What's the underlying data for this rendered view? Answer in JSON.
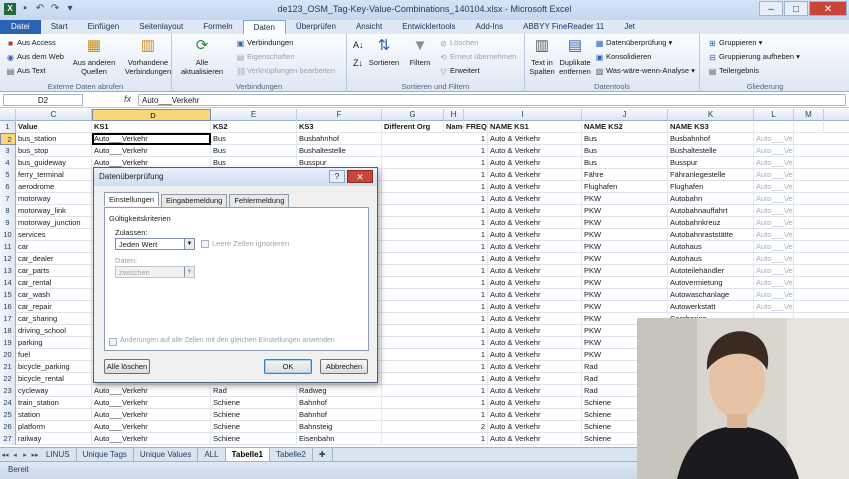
{
  "window": {
    "title": "de123_OSM_Tag-Key-Value-Combinations_140104.xlsx - Microsoft Excel"
  },
  "tabs": [
    "Datei",
    "Start",
    "Einfügen",
    "Seitenlayout",
    "Formeln",
    "Daten",
    "Überprüfen",
    "Ansicht",
    "Entwicklertools",
    "Add-Ins",
    "ABBYY FineReader 11",
    "Jet"
  ],
  "active_tab": "Daten",
  "ribbon": {
    "external": {
      "items": [
        "Aus Access",
        "Aus dem Web",
        "Aus Text"
      ],
      "other_sources": "Aus anderen Quellen",
      "existing": "Vorhandene Verbindungen",
      "label": "Externe Daten abrufen"
    },
    "connections": {
      "refresh": "Alle aktualisieren",
      "items": [
        "Verbindungen",
        "Eigenschaften",
        "Verknüpfungen bearbeiten"
      ],
      "label": "Verbindungen"
    },
    "sort": {
      "items": [
        "Sortieren",
        "Filtern"
      ],
      "side": [
        "Löschen",
        "Erneut übernehmen",
        "Erweitert"
      ],
      "label": "Sortieren und Filtern"
    },
    "tools": {
      "big": [
        "Text in Spalten",
        "Duplikate entfernen"
      ],
      "items": [
        "Datenüberprüfung",
        "Konsolidieren",
        "Was-wäre-wenn-Analyse"
      ],
      "label": "Datentools"
    },
    "outline": {
      "items": [
        "Gruppieren",
        "Gruppierung aufheben",
        "Teilergebnis"
      ],
      "label": "Gliederung"
    }
  },
  "formula_bar": {
    "cell": "D2",
    "fx": "fx",
    "value": "Auto___Verkehr"
  },
  "columns": [
    "C",
    "D",
    "E",
    "F",
    "G",
    "H",
    "I",
    "J",
    "K",
    "L",
    "M"
  ],
  "header_row": [
    "Value",
    "KS1",
    "KS2",
    "KS3",
    "Different Org",
    "Name",
    "FREQ",
    "NAME KS1",
    "NAME KS2",
    "NAME KS3",
    "",
    ""
  ],
  "rows": [
    {
      "n": "2",
      "v": "bus_station",
      "ks1": "Auto___Verkehr",
      "ks2": "Bus",
      "ks3": "Busbahnhof",
      "f": "1",
      "k1": "Auto & Verkehr",
      "k2": "Bus",
      "k3": "Busbahnhof",
      "l": "Auto___Verkehr"
    },
    {
      "n": "3",
      "v": "bus_stop",
      "ks1": "Auto___Verkehr",
      "ks2": "Bus",
      "ks3": "Bushaltestelle",
      "f": "1",
      "k1": "Auto & Verkehr",
      "k2": "Bus",
      "k3": "Bushaltestelle",
      "l": "Auto___Verkehr"
    },
    {
      "n": "4",
      "v": "bus_guideway",
      "ks1": "Auto___Verkehr",
      "ks2": "Bus",
      "ks3": "Busspur",
      "f": "1",
      "k1": "Auto & Verkehr",
      "k2": "Bus",
      "k3": "Busspur",
      "l": "Auto___Verkehr"
    },
    {
      "n": "5",
      "v": "ferry_terminal",
      "ks1": "Auto___Verkehr",
      "ks2": "",
      "ks3": "",
      "f": "1",
      "k1": "Auto & Verkehr",
      "k2": "Fähre",
      "k3": "Fähranlegestelle",
      "l": "Auto___Verkehr"
    },
    {
      "n": "6",
      "v": "aerodrome",
      "ks1": "Auto___Verkehr",
      "ks2": "",
      "ks3": "",
      "f": "1",
      "k1": "Auto & Verkehr",
      "k2": "Flughafen",
      "k3": "Flughafen",
      "l": "Auto___Verkehr"
    },
    {
      "n": "7",
      "v": "motorway",
      "ks1": "",
      "ks2": "",
      "ks3": "",
      "f": "1",
      "k1": "Auto & Verkehr",
      "k2": "PKW",
      "k3": "Autobahn",
      "l": "Auto___Verkehr"
    },
    {
      "n": "8",
      "v": "motorway_link",
      "ks1": "",
      "ks2": "",
      "ks3": "",
      "f": "1",
      "k1": "Auto & Verkehr",
      "k2": "PKW",
      "k3": "Autobahnauffahrt",
      "l": "Auto___Verkehr"
    },
    {
      "n": "9",
      "v": "motorway_junction",
      "ks1": "",
      "ks2": "",
      "ks3": "",
      "f": "1",
      "k1": "Auto & Verkehr",
      "k2": "PKW",
      "k3": "Autobahnkreuz",
      "l": "Auto___Verkehr"
    },
    {
      "n": "10",
      "v": "services",
      "ks1": "",
      "ks2": "",
      "ks3": "",
      "f": "1",
      "k1": "Auto & Verkehr",
      "k2": "PKW",
      "k3": "Autobahnraststätte",
      "l": "Auto___Verkehr"
    },
    {
      "n": "11",
      "v": "car",
      "ks1": "",
      "ks2": "",
      "ks3": "",
      "f": "1",
      "k1": "Auto & Verkehr",
      "k2": "PKW",
      "k3": "Autohaus",
      "l": "Auto___Verkehr"
    },
    {
      "n": "12",
      "v": "car_dealer",
      "ks1": "",
      "ks2": "",
      "ks3": "",
      "f": "1",
      "k1": "Auto & Verkehr",
      "k2": "PKW",
      "k3": "Autohaus",
      "l": "Auto___Verkehr"
    },
    {
      "n": "13",
      "v": "car_parts",
      "ks1": "",
      "ks2": "",
      "ks3": "",
      "f": "1",
      "k1": "Auto & Verkehr",
      "k2": "PKW",
      "k3": "Autoteilehändler",
      "l": "Auto___Verkehr"
    },
    {
      "n": "14",
      "v": "car_rental",
      "ks1": "",
      "ks2": "",
      "ks3": "",
      "f": "1",
      "k1": "Auto & Verkehr",
      "k2": "PKW",
      "k3": "Autovermietung",
      "l": "Auto___Verkehr"
    },
    {
      "n": "15",
      "v": "car_wash",
      "ks1": "",
      "ks2": "",
      "ks3": "",
      "f": "1",
      "k1": "Auto & Verkehr",
      "k2": "PKW",
      "k3": "Autowaschanlage",
      "l": "Auto___Verkehr"
    },
    {
      "n": "16",
      "v": "car_repair",
      "ks1": "",
      "ks2": "",
      "ks3": "",
      "f": "1",
      "k1": "Auto & Verkehr",
      "k2": "PKW",
      "k3": "Autowerkstatt",
      "l": "Auto___Verkehr"
    },
    {
      "n": "17",
      "v": "car_sharing",
      "ks1": "",
      "ks2": "",
      "ks3": "",
      "f": "1",
      "k1": "Auto & Verkehr",
      "k2": "PKW",
      "k3": "Carsharing",
      "l": ""
    },
    {
      "n": "18",
      "v": "driving_school",
      "ks1": "",
      "ks2": "",
      "ks3": "",
      "f": "1",
      "k1": "Auto & Verkehr",
      "k2": "PKW",
      "k3": "",
      "l": ""
    },
    {
      "n": "19",
      "v": "parking",
      "ks1": "",
      "ks2": "",
      "ks3": "",
      "f": "1",
      "k1": "Auto & Verkehr",
      "k2": "PKW",
      "k3": "",
      "l": ""
    },
    {
      "n": "20",
      "v": "fuel",
      "ks1": "",
      "ks2": "",
      "ks3": "",
      "f": "1",
      "k1": "Auto & Verkehr",
      "k2": "PKW",
      "k3": "",
      "l": ""
    },
    {
      "n": "21",
      "v": "bicycle_parking",
      "ks1": "",
      "ks2": "",
      "ks3": "",
      "f": "1",
      "k1": "Auto & Verkehr",
      "k2": "Rad",
      "k3": "",
      "l": ""
    },
    {
      "n": "22",
      "v": "bicycle_rental",
      "ks1": "",
      "ks2": "",
      "ks3": "",
      "f": "1",
      "k1": "Auto & Verkehr",
      "k2": "Rad",
      "k3": "",
      "l": ""
    },
    {
      "n": "23",
      "v": "cycleway",
      "ks1": "Auto___Verkehr",
      "ks2": "Rad",
      "ks3": "Radweg",
      "f": "1",
      "k1": "Auto & Verkehr",
      "k2": "Rad",
      "k3": "",
      "l": ""
    },
    {
      "n": "24",
      "v": "train_station",
      "ks1": "Auto___Verkehr",
      "ks2": "Schiene",
      "ks3": "Bahnhof",
      "f": "1",
      "k1": "Auto & Verkehr",
      "k2": "Schiene",
      "k3": "",
      "l": ""
    },
    {
      "n": "25",
      "v": "station",
      "ks1": "Auto___Verkehr",
      "ks2": "Schiene",
      "ks3": "Bahnhof",
      "f": "1",
      "k1": "Auto & Verkehr",
      "k2": "Schiene",
      "k3": "",
      "l": ""
    },
    {
      "n": "26",
      "v": "platform",
      "ks1": "Auto___Verkehr",
      "ks2": "Schiene",
      "ks3": "Bahnsteig",
      "f": "2",
      "k1": "Auto & Verkehr",
      "k2": "Schiene",
      "k3": "",
      "l": ""
    },
    {
      "n": "27",
      "v": "railway",
      "ks1": "Auto___Verkehr",
      "ks2": "Schiene",
      "ks3": "Eisenbahn",
      "f": "1",
      "k1": "Auto & Verkehr",
      "k2": "Schiene",
      "k3": "",
      "l": ""
    }
  ],
  "sheets": [
    "LINUS",
    "Unique Tags",
    "Unique Values",
    "ALL",
    "Tabelle1",
    "Tabelle2"
  ],
  "active_sheet": "Tabelle1",
  "status": "Bereit",
  "dialog": {
    "title": "Datenüberprüfung",
    "help": "?",
    "close": "✕",
    "tabs": [
      "Einstellungen",
      "Eingabemeldung",
      "Fehlermeldung"
    ],
    "criteria": "Gültigkeitskriterien",
    "allow_label": "Zulassen:",
    "allow_value": "Jeden Wert",
    "ignore_blank": "Leere Zellen ignorieren",
    "data_label": "Daten:",
    "data_value": "zwischen",
    "apply_all": "Änderungen auf alle Zellen mit den gleichen Einstellungen anwenden",
    "clear_all": "Alle löschen",
    "ok": "OK",
    "cancel": "Abbrechen"
  },
  "colors": {
    "file_tab": "#2a63b3",
    "selection": "#f8d779",
    "close": "#c9453a"
  }
}
